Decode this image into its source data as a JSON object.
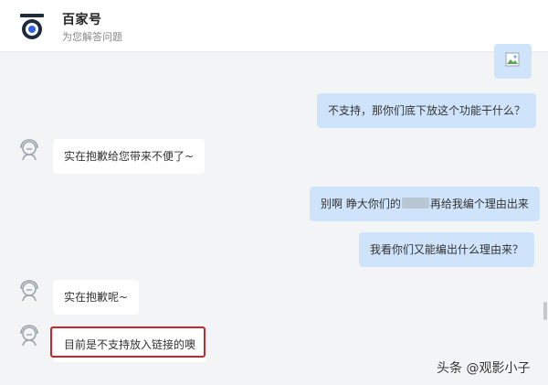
{
  "header": {
    "title": "百家号",
    "subtitle": "为您解答问题"
  },
  "messages": [
    {
      "id": "m1",
      "role": "user",
      "type": "image"
    },
    {
      "id": "m2",
      "role": "user",
      "text": "不支持，那你们底下放这个功能干什么？"
    },
    {
      "id": "m3",
      "role": "bot",
      "text": "实在抱歉给您带来不便了~"
    },
    {
      "id": "m4",
      "role": "user",
      "text_before": "别啊 睁大你们的",
      "text_after": "再给我编个理由出来"
    },
    {
      "id": "m5",
      "role": "user",
      "text": "我看你们又能编出什么理由来？"
    },
    {
      "id": "m6",
      "role": "bot",
      "text": "实在抱歉呢~"
    },
    {
      "id": "m7",
      "role": "bot",
      "text": "目前是不支持放入链接的噢"
    }
  ],
  "watermark": "头条 @观影小子",
  "colors": {
    "user_bubble": "#cfe4fb",
    "bot_bubble": "#ffffff",
    "background": "#f3f4f6",
    "highlight": "#c8272d"
  }
}
